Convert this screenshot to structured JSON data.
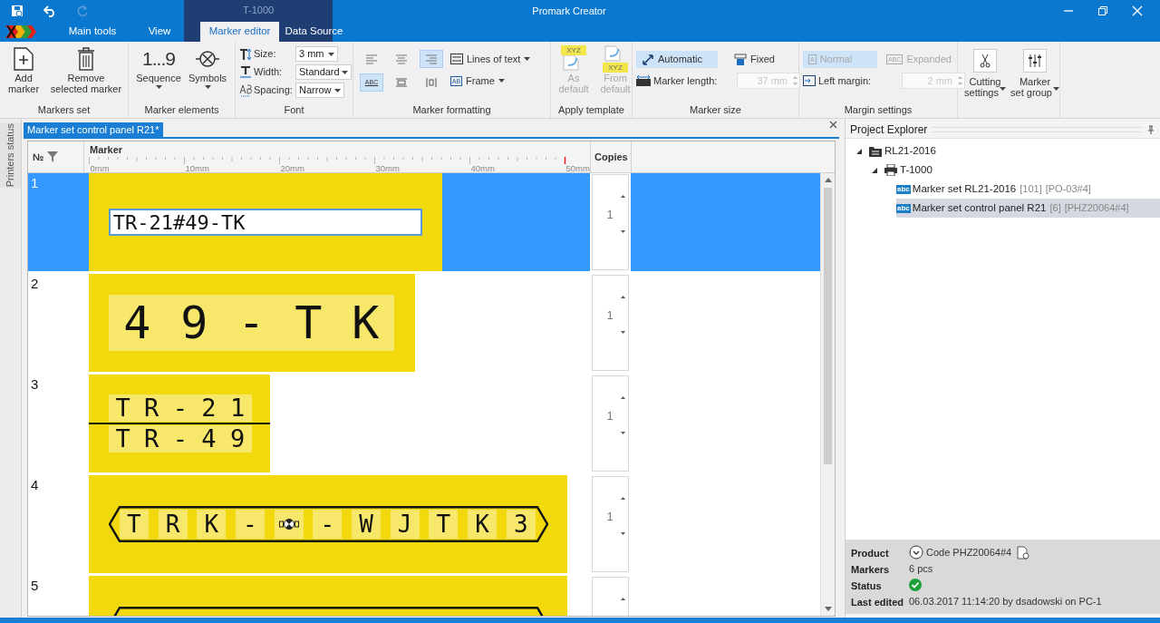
{
  "window": {
    "title": "Promark Creator"
  },
  "quick_access": [
    {
      "disabled": false
    },
    {
      "disabled": false
    },
    {
      "disabled": true
    }
  ],
  "contextual_tab_group": {
    "label": "T-1000"
  },
  "tabs": [
    {
      "label": "Main tools",
      "selected": false
    },
    {
      "label": "View",
      "selected": false
    },
    {
      "label": "Marker editor",
      "selected": true
    },
    {
      "label": "Data Source",
      "selected": false
    }
  ],
  "ribbon": {
    "markers_set": {
      "label": "Markers set",
      "buttons": [
        {
          "lines": [
            "Add",
            "marker"
          ]
        },
        {
          "lines": [
            "Remove",
            "selected marker"
          ]
        }
      ]
    },
    "marker_elements": {
      "label": "Marker elements",
      "buttons": [
        {
          "icon_text": "1...9",
          "lines": [
            "Sequence"
          ],
          "dropdown": true
        },
        {
          "lines": [
            "Symbols"
          ],
          "dropdown": true
        }
      ]
    },
    "font": {
      "label": "Font",
      "fields": [
        {
          "label": "Size:",
          "value": "3 mm"
        },
        {
          "label": "Width:",
          "value": "Standard"
        },
        {
          "label": "Spacing:",
          "value": "Narrow"
        }
      ]
    },
    "marker_formatting": {
      "label": "Marker formatting",
      "align_buttons": [
        {
          "selected": false
        },
        {
          "selected": false
        },
        {
          "selected": true
        }
      ],
      "text_buttons": [
        {
          "icon_text": "ABC",
          "selected": true
        },
        {
          "selected": false
        },
        {
          "selected": false
        }
      ],
      "menus": [
        {
          "label": "Lines of text"
        },
        {
          "label": "Frame",
          "icon_text": "AB"
        }
      ]
    },
    "apply_template": {
      "label": "Apply template",
      "buttons": [
        {
          "lines": [
            "As",
            "default"
          ],
          "icon_text": "XYZ",
          "disabled": true
        },
        {
          "lines": [
            "From",
            "default"
          ],
          "icon_text": "XYZ",
          "disabled": true
        }
      ]
    },
    "marker_size": {
      "label": "Marker size",
      "toggles": [
        {
          "label": "Automatic",
          "selected": true
        },
        {
          "label": "Fixed",
          "selected": false
        }
      ],
      "length": {
        "label": "Marker length:",
        "value": "37 mm",
        "disabled": true
      }
    },
    "margin_settings": {
      "label": "Margin settings",
      "toggles": [
        {
          "label": "Normal",
          "icon_text": "A",
          "selected": true,
          "disabled": true
        },
        {
          "label": "Expanded",
          "icon_text": "ABC",
          "selected": false,
          "disabled": true
        }
      ],
      "left_margin": {
        "label": "Left margin:",
        "value": "2 mm",
        "disabled": true
      }
    },
    "group_buttons": [
      {
        "lines": [
          "Cutting",
          "settings"
        ],
        "dropdown": true
      },
      {
        "lines": [
          "Marker",
          "set group"
        ],
        "dropdown": true
      }
    ]
  },
  "side_panel": {
    "label": "Printers status"
  },
  "document_tab": {
    "title": "Marker set control panel R21*"
  },
  "grid": {
    "columns": [
      {
        "label": "№"
      },
      {
        "label": "Marker"
      },
      {
        "label": "Copies"
      }
    ],
    "ruler_labels": [
      "0mm",
      "10mm",
      "20mm",
      "30mm",
      "40mm",
      "50mm"
    ],
    "rows": [
      {
        "number": "1",
        "selected": true,
        "marker": {
          "kind": "edit",
          "value": "TR-21#49-TK"
        },
        "copies": "1"
      },
      {
        "number": "2",
        "selected": false,
        "marker": {
          "kind": "large",
          "text": "4 9 - T K"
        },
        "copies": "1"
      },
      {
        "number": "3",
        "selected": false,
        "marker": {
          "kind": "two-line",
          "lines": [
            "T R - 2 1",
            "T R - 4 9"
          ]
        },
        "copies": "1"
      },
      {
        "number": "4",
        "selected": false,
        "marker": {
          "kind": "hex-frame",
          "text_before": "T R K -",
          "symbol": true,
          "text_after": "- W J T K 3"
        },
        "copies": "1"
      },
      {
        "number": "5",
        "selected": false,
        "marker": {
          "kind": "hex-frame"
        }
      }
    ]
  },
  "project_explorer": {
    "title": "Project Explorer",
    "tree": [
      {
        "label": "RL21-2016",
        "kind": "folder",
        "expanded": true,
        "selected": false,
        "children": [
          {
            "label": "T-1000",
            "kind": "printer",
            "expanded": true,
            "selected": false,
            "children": [
              {
                "label": "Marker set RL21-2016",
                "badge": "abc",
                "count": "[101]",
                "code": "[PO-03#4]",
                "kind": "marker-set",
                "selected": false
              },
              {
                "label": "Marker set control panel R21",
                "badge": "abc",
                "count": "[6]",
                "code": "[PHZ20064#4]",
                "kind": "marker-set",
                "selected": true
              }
            ]
          }
        ]
      }
    ]
  },
  "details": [
    {
      "label": "Product",
      "kind": "product",
      "value": "Code PHZ20064#4"
    },
    {
      "label": "Markers",
      "kind": "text",
      "value": "6 pcs"
    },
    {
      "label": "Status",
      "kind": "status",
      "ok": true
    },
    {
      "label": "Last edited",
      "kind": "text",
      "value": "06.03.2017 11:14:20 by dsadowski on PC-1"
    }
  ]
}
